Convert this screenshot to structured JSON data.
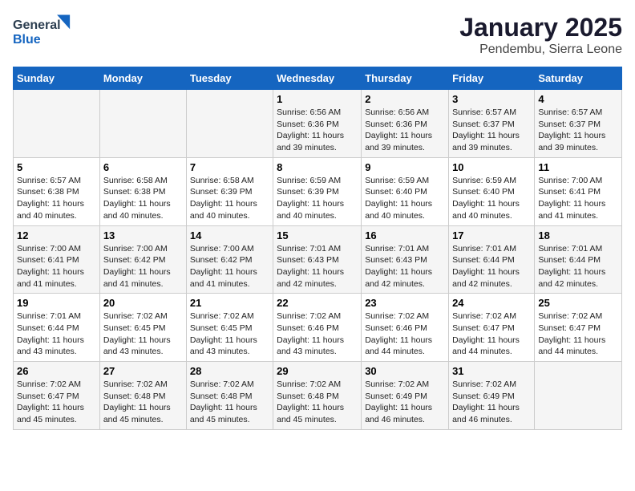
{
  "header": {
    "logo_general": "General",
    "logo_blue": "Blue",
    "main_title": "January 2025",
    "subtitle": "Pendembu, Sierra Leone"
  },
  "days_of_week": [
    "Sunday",
    "Monday",
    "Tuesday",
    "Wednesday",
    "Thursday",
    "Friday",
    "Saturday"
  ],
  "weeks": [
    [
      {
        "day": "",
        "sunrise": "",
        "sunset": "",
        "daylight": ""
      },
      {
        "day": "",
        "sunrise": "",
        "sunset": "",
        "daylight": ""
      },
      {
        "day": "",
        "sunrise": "",
        "sunset": "",
        "daylight": ""
      },
      {
        "day": "1",
        "sunrise": "Sunrise: 6:56 AM",
        "sunset": "Sunset: 6:36 PM",
        "daylight": "Daylight: 11 hours and 39 minutes."
      },
      {
        "day": "2",
        "sunrise": "Sunrise: 6:56 AM",
        "sunset": "Sunset: 6:36 PM",
        "daylight": "Daylight: 11 hours and 39 minutes."
      },
      {
        "day": "3",
        "sunrise": "Sunrise: 6:57 AM",
        "sunset": "Sunset: 6:37 PM",
        "daylight": "Daylight: 11 hours and 39 minutes."
      },
      {
        "day": "4",
        "sunrise": "Sunrise: 6:57 AM",
        "sunset": "Sunset: 6:37 PM",
        "daylight": "Daylight: 11 hours and 39 minutes."
      }
    ],
    [
      {
        "day": "5",
        "sunrise": "Sunrise: 6:57 AM",
        "sunset": "Sunset: 6:38 PM",
        "daylight": "Daylight: 11 hours and 40 minutes."
      },
      {
        "day": "6",
        "sunrise": "Sunrise: 6:58 AM",
        "sunset": "Sunset: 6:38 PM",
        "daylight": "Daylight: 11 hours and 40 minutes."
      },
      {
        "day": "7",
        "sunrise": "Sunrise: 6:58 AM",
        "sunset": "Sunset: 6:39 PM",
        "daylight": "Daylight: 11 hours and 40 minutes."
      },
      {
        "day": "8",
        "sunrise": "Sunrise: 6:59 AM",
        "sunset": "Sunset: 6:39 PM",
        "daylight": "Daylight: 11 hours and 40 minutes."
      },
      {
        "day": "9",
        "sunrise": "Sunrise: 6:59 AM",
        "sunset": "Sunset: 6:40 PM",
        "daylight": "Daylight: 11 hours and 40 minutes."
      },
      {
        "day": "10",
        "sunrise": "Sunrise: 6:59 AM",
        "sunset": "Sunset: 6:40 PM",
        "daylight": "Daylight: 11 hours and 40 minutes."
      },
      {
        "day": "11",
        "sunrise": "Sunrise: 7:00 AM",
        "sunset": "Sunset: 6:41 PM",
        "daylight": "Daylight: 11 hours and 41 minutes."
      }
    ],
    [
      {
        "day": "12",
        "sunrise": "Sunrise: 7:00 AM",
        "sunset": "Sunset: 6:41 PM",
        "daylight": "Daylight: 11 hours and 41 minutes."
      },
      {
        "day": "13",
        "sunrise": "Sunrise: 7:00 AM",
        "sunset": "Sunset: 6:42 PM",
        "daylight": "Daylight: 11 hours and 41 minutes."
      },
      {
        "day": "14",
        "sunrise": "Sunrise: 7:00 AM",
        "sunset": "Sunset: 6:42 PM",
        "daylight": "Daylight: 11 hours and 41 minutes."
      },
      {
        "day": "15",
        "sunrise": "Sunrise: 7:01 AM",
        "sunset": "Sunset: 6:43 PM",
        "daylight": "Daylight: 11 hours and 42 minutes."
      },
      {
        "day": "16",
        "sunrise": "Sunrise: 7:01 AM",
        "sunset": "Sunset: 6:43 PM",
        "daylight": "Daylight: 11 hours and 42 minutes."
      },
      {
        "day": "17",
        "sunrise": "Sunrise: 7:01 AM",
        "sunset": "Sunset: 6:44 PM",
        "daylight": "Daylight: 11 hours and 42 minutes."
      },
      {
        "day": "18",
        "sunrise": "Sunrise: 7:01 AM",
        "sunset": "Sunset: 6:44 PM",
        "daylight": "Daylight: 11 hours and 42 minutes."
      }
    ],
    [
      {
        "day": "19",
        "sunrise": "Sunrise: 7:01 AM",
        "sunset": "Sunset: 6:44 PM",
        "daylight": "Daylight: 11 hours and 43 minutes."
      },
      {
        "day": "20",
        "sunrise": "Sunrise: 7:02 AM",
        "sunset": "Sunset: 6:45 PM",
        "daylight": "Daylight: 11 hours and 43 minutes."
      },
      {
        "day": "21",
        "sunrise": "Sunrise: 7:02 AM",
        "sunset": "Sunset: 6:45 PM",
        "daylight": "Daylight: 11 hours and 43 minutes."
      },
      {
        "day": "22",
        "sunrise": "Sunrise: 7:02 AM",
        "sunset": "Sunset: 6:46 PM",
        "daylight": "Daylight: 11 hours and 43 minutes."
      },
      {
        "day": "23",
        "sunrise": "Sunrise: 7:02 AM",
        "sunset": "Sunset: 6:46 PM",
        "daylight": "Daylight: 11 hours and 44 minutes."
      },
      {
        "day": "24",
        "sunrise": "Sunrise: 7:02 AM",
        "sunset": "Sunset: 6:47 PM",
        "daylight": "Daylight: 11 hours and 44 minutes."
      },
      {
        "day": "25",
        "sunrise": "Sunrise: 7:02 AM",
        "sunset": "Sunset: 6:47 PM",
        "daylight": "Daylight: 11 hours and 44 minutes."
      }
    ],
    [
      {
        "day": "26",
        "sunrise": "Sunrise: 7:02 AM",
        "sunset": "Sunset: 6:47 PM",
        "daylight": "Daylight: 11 hours and 45 minutes."
      },
      {
        "day": "27",
        "sunrise": "Sunrise: 7:02 AM",
        "sunset": "Sunset: 6:48 PM",
        "daylight": "Daylight: 11 hours and 45 minutes."
      },
      {
        "day": "28",
        "sunrise": "Sunrise: 7:02 AM",
        "sunset": "Sunset: 6:48 PM",
        "daylight": "Daylight: 11 hours and 45 minutes."
      },
      {
        "day": "29",
        "sunrise": "Sunrise: 7:02 AM",
        "sunset": "Sunset: 6:48 PM",
        "daylight": "Daylight: 11 hours and 45 minutes."
      },
      {
        "day": "30",
        "sunrise": "Sunrise: 7:02 AM",
        "sunset": "Sunset: 6:49 PM",
        "daylight": "Daylight: 11 hours and 46 minutes."
      },
      {
        "day": "31",
        "sunrise": "Sunrise: 7:02 AM",
        "sunset": "Sunset: 6:49 PM",
        "daylight": "Daylight: 11 hours and 46 minutes."
      },
      {
        "day": "",
        "sunrise": "",
        "sunset": "",
        "daylight": ""
      }
    ]
  ]
}
